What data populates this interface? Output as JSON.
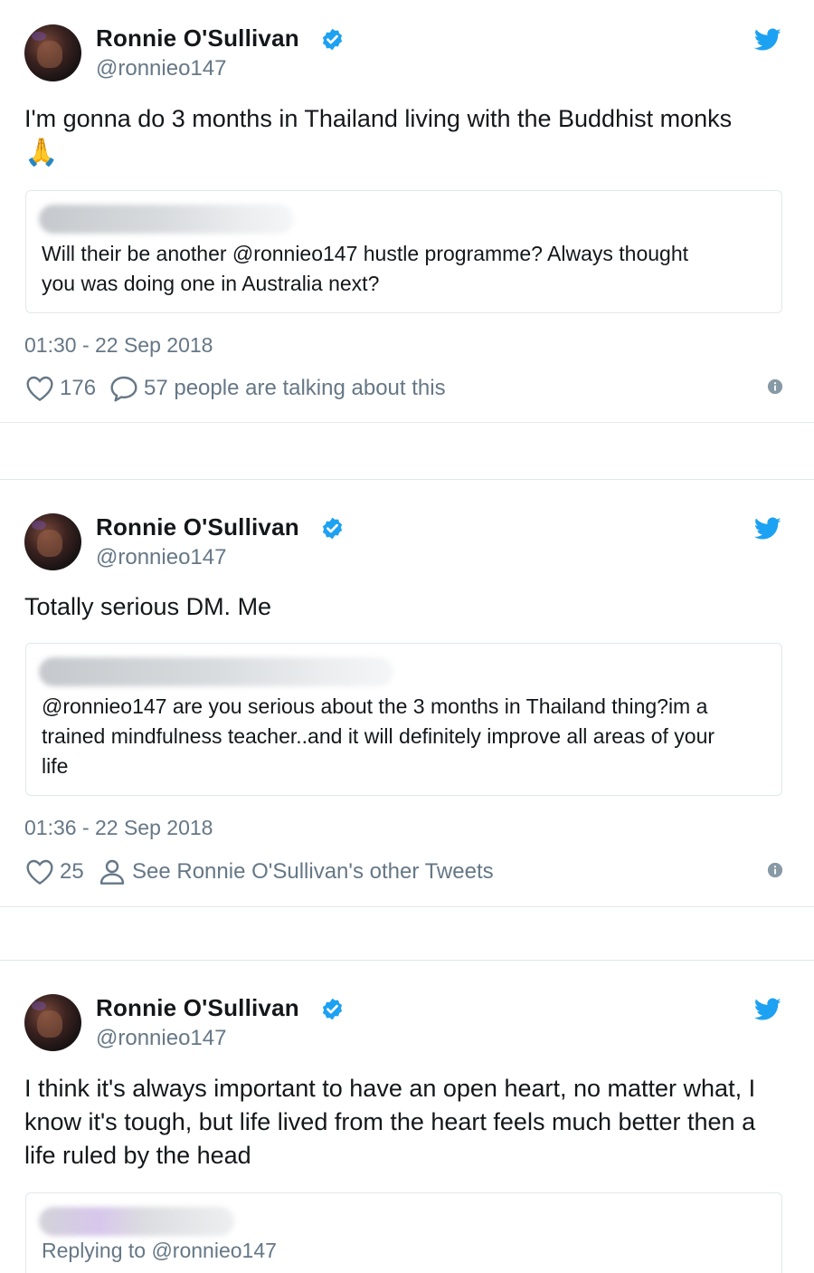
{
  "tweets": [
    {
      "author_name": "Ronnie O'Sullivan",
      "handle": "@ronnieo147",
      "text": "I'm gonna do 3 months in Thailand living with the Buddhist monks",
      "emoji": "🙏",
      "quoted": {
        "lines": [
          "Will their be another @ronnieo147 hustle programme? Always thought",
          "you was doing one in Australia next?"
        ]
      },
      "timestamp": "01:30 - 22 Sep 2018",
      "likes": "176",
      "secondary_action": "57 people are talking about this",
      "secondary_icon": "comment-icon"
    },
    {
      "author_name": "Ronnie O'Sullivan",
      "handle": "@ronnieo147",
      "text": "Totally serious DM. Me",
      "quoted": {
        "lines": [
          "@ronnieo147 are you serious about the 3 months in Thailand thing?im a",
          "trained mindfulness teacher..and it will definitely improve all areas of your",
          "life"
        ]
      },
      "timestamp": "01:36 - 22 Sep 2018",
      "likes": "25",
      "secondary_action": "See Ronnie O'Sullivan's other Tweets",
      "secondary_icon": "person-icon"
    },
    {
      "author_name": "Ronnie O'Sullivan",
      "handle": "@ronnieo147",
      "text_lines": [
        "I think it's always important to have an open heart, no matter what, I",
        "know it's tough, but life lived from the heart feels much better then a",
        "life ruled by the head"
      ],
      "quoted": {
        "replying_to": "Replying to @ronnieo147"
      }
    }
  ],
  "colors": {
    "twitter_blue": "#1da1f2",
    "text_primary": "#14171a",
    "text_secondary": "#657786",
    "border": "#e1e8ed"
  }
}
